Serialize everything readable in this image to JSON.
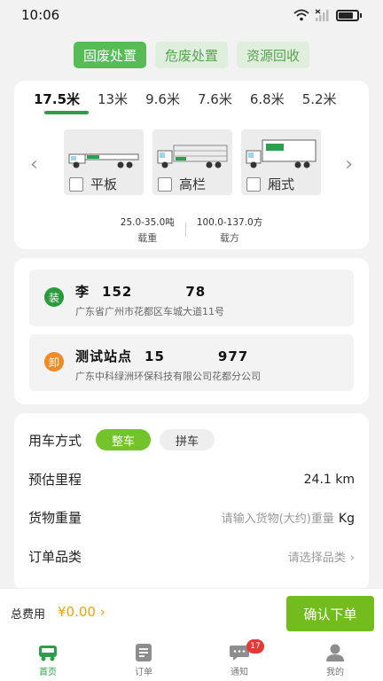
{
  "status_bar": {
    "time": "10:06"
  },
  "top_tabs": [
    {
      "label": "固废处置",
      "active": true
    },
    {
      "label": "危废处置",
      "active": false
    },
    {
      "label": "资源回收",
      "active": false
    }
  ],
  "truck_sizes": [
    {
      "label": "17.5米",
      "active": true
    },
    {
      "label": "13米"
    },
    {
      "label": "9.6米"
    },
    {
      "label": "7.6米"
    },
    {
      "label": "6.8米"
    },
    {
      "label": "5.2米"
    }
  ],
  "truck_types": [
    {
      "label": "平板"
    },
    {
      "label": "高栏"
    },
    {
      "label": "厢式"
    }
  ],
  "specs": {
    "load_value": "25.0-35.0吨",
    "load_label": "载重",
    "volume_value": "100.0-137.0方",
    "volume_label": "载方"
  },
  "loading": {
    "badge": "装",
    "name": "李",
    "phone_start": "152",
    "phone_end": "78",
    "address": "广东省广州市花都区车城大道11号"
  },
  "unloading": {
    "badge": "卸",
    "name": "测试站点",
    "phone_start": "15",
    "phone_end": "977",
    "address": "广东中科绿洲环保科技有限公司花都分公司"
  },
  "form": {
    "usage_label": "用车方式",
    "usage_options": [
      "整车",
      "拼车"
    ],
    "distance_label": "预估里程",
    "distance_value": "24.1 km",
    "weight_label": "货物重量",
    "weight_placeholder": "请输入货物(大约)重量",
    "weight_unit": "Kg",
    "category_label": "订单品类",
    "category_placeholder": "请选择品类"
  },
  "bottom": {
    "total_label": "总费用",
    "total_value": "¥0.00",
    "confirm_label": "确认下单"
  },
  "nav": [
    {
      "label": "首页",
      "active": true,
      "icon": "truck-icon"
    },
    {
      "label": "订单",
      "icon": "order-icon"
    },
    {
      "label": "通知",
      "icon": "message-icon",
      "badge": "17"
    },
    {
      "label": "我的",
      "icon": "profile-icon"
    }
  ],
  "colors": {
    "brand_green": "#57bb56",
    "accent_green": "#73bc1e",
    "price_yellow": "#e9a600"
  }
}
